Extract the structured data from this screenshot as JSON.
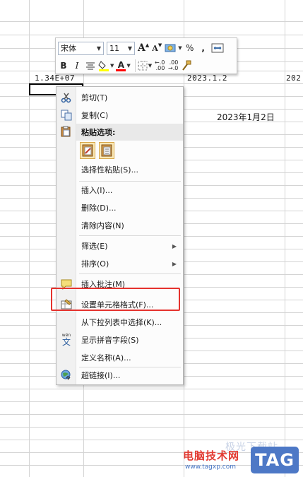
{
  "sheet": {
    "cells": {
      "a_value": "1.34E+07",
      "b_value": "2023.1.2",
      "c_value_partial": "202",
      "formatted_date": "2023年1月2日"
    }
  },
  "mini_toolbar": {
    "font_name": "宋体",
    "font_size": "11",
    "grow_font": "A",
    "shrink_font": "A",
    "percent": "%",
    "comma": ",",
    "bold": "B",
    "italic": "I",
    "font_color_glyph": "A",
    "font_color": "#ff0000",
    "fill_color": "#ffff00"
  },
  "context_menu": {
    "cut": "剪切(T)",
    "copy": "复制(C)",
    "paste_options": "粘贴选项:",
    "paste_special": "选择性粘贴(S)...",
    "insert": "插入(I)...",
    "delete": "删除(D)...",
    "clear_contents": "清除内容(N)",
    "filter": "筛选(E)",
    "sort": "排序(O)",
    "insert_comment": "插入批注(M)",
    "format_cells": "设置单元格格式(F)...",
    "pick_from_list": "从下拉列表中选择(K)...",
    "show_phonetic": "显示拼音字段(S)",
    "define_name": "定义名称(A)...",
    "hyperlink": "超链接(I)..."
  },
  "watermark": {
    "site_name": "电脑技术网",
    "url": "www.tagxp.com",
    "tag": "TAG",
    "ghost_text": "极光下载站"
  },
  "colors": {
    "highlight_border": "#e5322d",
    "watermark_blue": "#4d78c6"
  }
}
